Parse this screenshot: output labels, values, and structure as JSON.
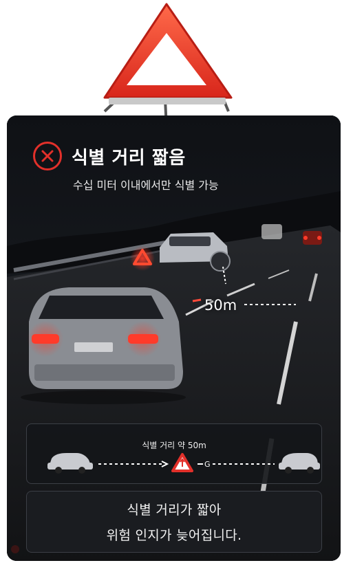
{
  "header": {
    "title": "식별 거리 짧음",
    "subtitle": "수십 미터 이내에서만 식별 가능",
    "status_icon": "close-circle-icon",
    "status_color": "#e2302a"
  },
  "scene": {
    "distance_label": "50m"
  },
  "diagram": {
    "caption": "식별 거리 약 50m"
  },
  "message": {
    "line1": "식별 거리가 짧아",
    "line2": "위험 인지가 늦어집니다."
  },
  "colors": {
    "panel_bg": "#121418",
    "warning_red": "#e2302a",
    "text_primary": "#ffffff"
  }
}
